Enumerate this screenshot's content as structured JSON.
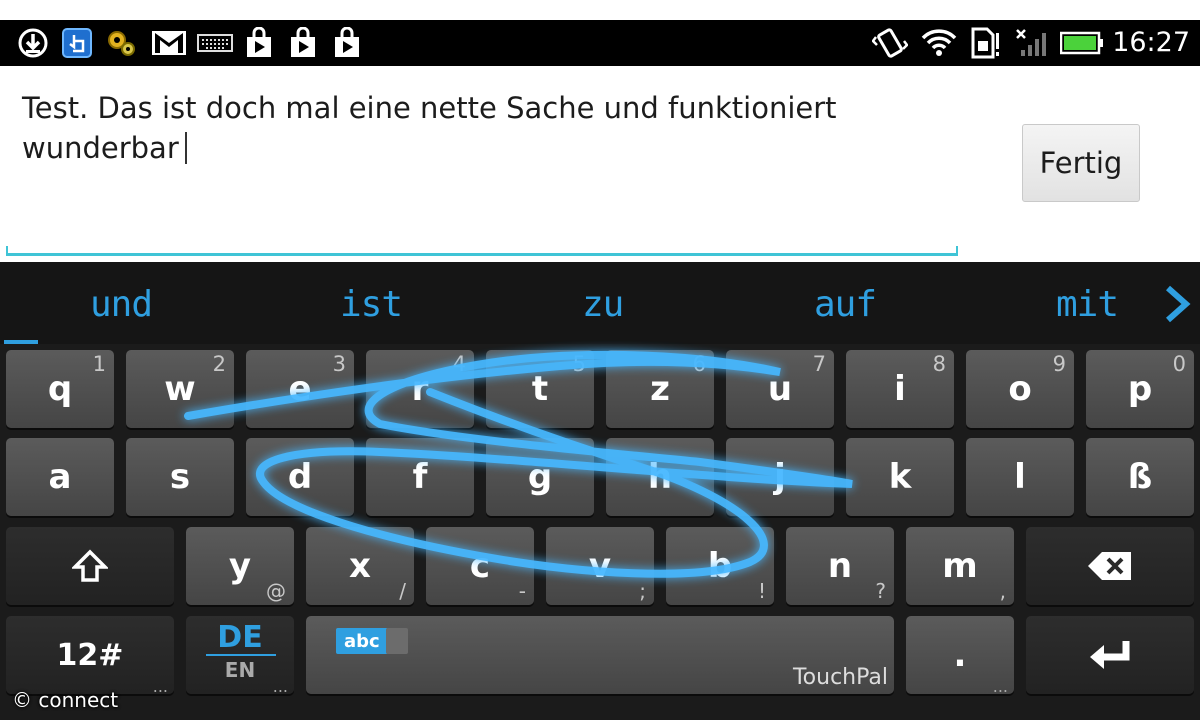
{
  "status_bar": {
    "left_icons": [
      "download-icon",
      "touch-app-icon",
      "settings-gear-icon",
      "gmail-icon",
      "keyboard-icon",
      "play-store-icon",
      "play-store-icon",
      "play-store-icon"
    ],
    "right_icons": [
      "vibrate-icon",
      "wifi-icon",
      "sim-alert-icon",
      "signal-icon",
      "battery-icon"
    ],
    "time": "16:27"
  },
  "editor": {
    "text": "Test. Das ist doch mal eine nette Sache und funktioniert wunderbar",
    "done_button": "Fertig",
    "accent_color": "#3fc4d6"
  },
  "keyboard": {
    "accent_color": "#2f9fe0",
    "suggestions": [
      "und",
      "ist",
      "zu",
      "auf",
      "mit"
    ],
    "rows": [
      [
        {
          "k": "q",
          "h": "1"
        },
        {
          "k": "w",
          "h": "2"
        },
        {
          "k": "e",
          "h": "3"
        },
        {
          "k": "r",
          "h": "4"
        },
        {
          "k": "t",
          "h": "5"
        },
        {
          "k": "z",
          "h": "6"
        },
        {
          "k": "u",
          "h": "7"
        },
        {
          "k": "i",
          "h": "8"
        },
        {
          "k": "o",
          "h": "9"
        },
        {
          "k": "p",
          "h": "0"
        }
      ],
      [
        {
          "k": "a"
        },
        {
          "k": "s"
        },
        {
          "k": "d"
        },
        {
          "k": "f"
        },
        {
          "k": "g"
        },
        {
          "k": "h"
        },
        {
          "k": "j"
        },
        {
          "k": "k"
        },
        {
          "k": "l"
        },
        {
          "k": "ß"
        }
      ],
      [
        {
          "k": "y",
          "s": "@"
        },
        {
          "k": "x",
          "s": "/"
        },
        {
          "k": "c",
          "s": "-"
        },
        {
          "k": "v",
          "s": ";"
        },
        {
          "k": "b",
          "s": "!"
        },
        {
          "k": "n",
          "s": "?"
        },
        {
          "k": "m",
          "s": ","
        }
      ]
    ],
    "symbols_key": "12#",
    "lang_primary": "DE",
    "lang_secondary": "EN",
    "mode_badge": "abc",
    "space_brand": "TouchPal",
    "period_key": ".",
    "more_dots": "..."
  },
  "watermark": "© connect"
}
